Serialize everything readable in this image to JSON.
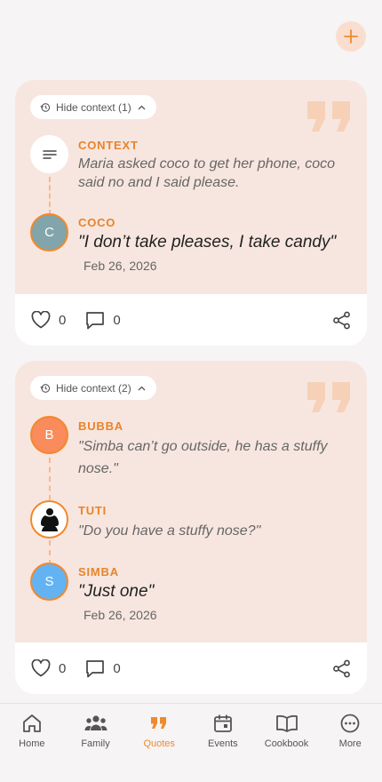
{
  "header": {
    "add_icon": "plus-icon"
  },
  "cards": [
    {
      "context_toggle": "Hide context (1)",
      "context": {
        "label": "CONTEXT",
        "text": "Maria asked coco to get her phone, coco said no and I said please."
      },
      "quote": {
        "speaker": "COCO",
        "initial": "C",
        "text": "\"I don’t take pleases, I take candy\"",
        "date": "Feb 26, 2026",
        "avatar_color": "#82a4ab"
      },
      "likes": "0",
      "comments": "0"
    },
    {
      "context_toggle": "Hide context (2)",
      "entries": [
        {
          "speaker": "BUBBA",
          "initial": "B",
          "text": "\"Simba can’t go outside, he has a stuffy nose.\"",
          "avatar_color": "#f98b5c"
        },
        {
          "speaker": "TUTI",
          "initial": "",
          "text": "\"Do you have a stuffy nose?\"",
          "avatar_color": "#ffffff"
        }
      ],
      "quote": {
        "speaker": "SIMBA",
        "initial": "S",
        "text": "\"Just one\"",
        "date": "Feb 26, 2026",
        "avatar_color": "#63b3f2"
      },
      "likes": "0",
      "comments": "0"
    }
  ],
  "nav": [
    {
      "label": "Home",
      "icon": "home-icon"
    },
    {
      "label": "Family",
      "icon": "family-icon"
    },
    {
      "label": "Quotes",
      "icon": "quotes-icon",
      "active": true
    },
    {
      "label": "Events",
      "icon": "calendar-icon"
    },
    {
      "label": "Cookbook",
      "icon": "book-icon"
    },
    {
      "label": "More",
      "icon": "more-icon"
    }
  ],
  "colors": {
    "accent": "#ee8a2e",
    "card_bg": "#f7e6df",
    "page_bg": "#f6f4f4"
  }
}
